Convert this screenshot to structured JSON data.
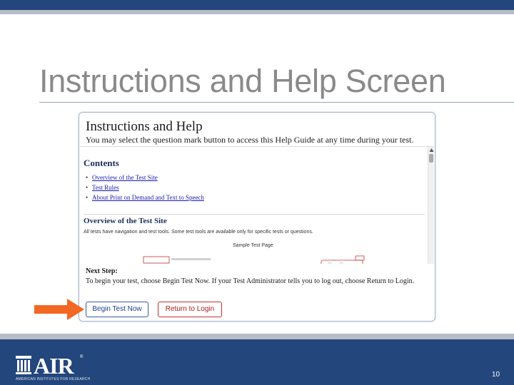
{
  "slide": {
    "title": "Instructions and Help Screen",
    "page_number": "10"
  },
  "help_screen": {
    "title": "Instructions and Help",
    "subtitle": "You may select the question mark button to access this Help Guide at any time during your test.",
    "contents_heading": "Contents",
    "toc": [
      "Overview of the Test Site",
      "Test Rules",
      "About Print on Demand and Text to Speech"
    ],
    "overview_heading": "Overview of the Test Site",
    "overview_text": "All tests have navigation and test tools. Some test tools are available only for specific tests or questions.",
    "sample_caption": "Sample Test Page",
    "next_step_heading": "Next Step:",
    "next_step_text": "To begin your test, choose Begin Test Now. If your Test Administrator tells you to log out, choose Return to Login.",
    "begin_button": "Begin Test Now",
    "return_button": "Return to Login"
  },
  "footer": {
    "logo_text": "AIR",
    "logo_reg": "®",
    "logo_tagline": "AMERICAN INSTITUTES FOR RESEARCH"
  },
  "colors": {
    "brand_navy": "#23467d",
    "stripe_gray": "#b7bcc6",
    "arrow_orange": "#f26722",
    "begin_blue": "#1e3d8f",
    "return_red": "#b01818"
  },
  "icons": {
    "arrow": "right-arrow-icon",
    "logo_mark": "air-building-icon",
    "scroll_up": "triangle-up-icon"
  }
}
